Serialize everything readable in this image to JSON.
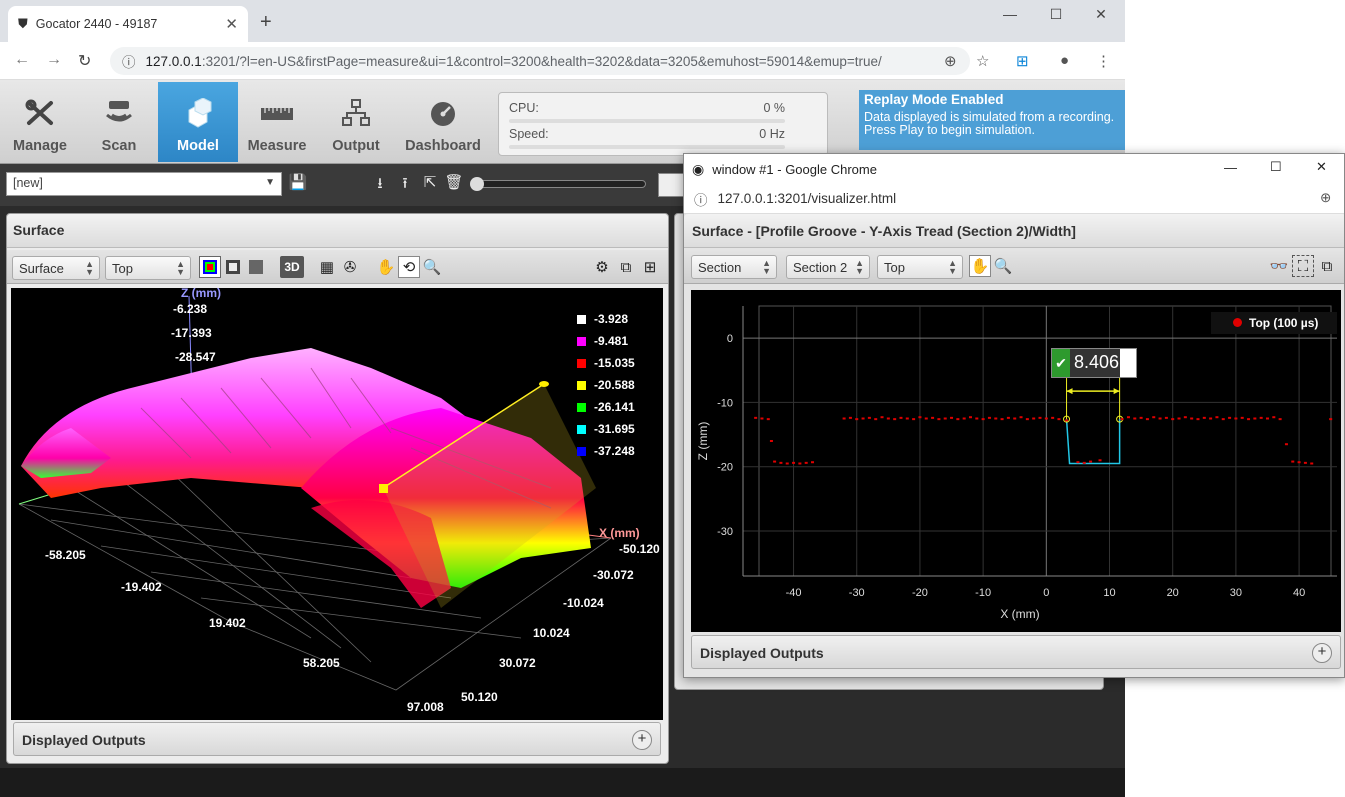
{
  "browser": {
    "tab_title": "Gocator 2440 - 49187",
    "url_host": "127.0.0.1",
    "url_rest": ":3201/?l=en-US&firstPage=measure&ui=1&control=3200&health=3202&data=3205&emuhost=59014&emup=true/"
  },
  "app": {
    "tabs": [
      {
        "label": "Manage",
        "icon": "wrench-screwdriver-icon"
      },
      {
        "label": "Scan",
        "icon": "scan-icon"
      },
      {
        "label": "Model",
        "icon": "cubes-icon",
        "active": true
      },
      {
        "label": "Measure",
        "icon": "ruler-icon"
      },
      {
        "label": "Output",
        "icon": "network-icon"
      },
      {
        "label": "Dashboard",
        "icon": "gauge-icon"
      }
    ],
    "stats": {
      "cpu_label": "CPU:",
      "cpu_value": "0 %",
      "speed_label": "Speed:",
      "speed_value": "0 Hz"
    },
    "replay": {
      "title": "Replay Mode Enabled",
      "line1": "Data displayed is simulated from a recording.",
      "line2": "Press Play to begin simulation."
    },
    "job_select_value": "[new]"
  },
  "surface_panel": {
    "title": "Surface",
    "view_select": "Surface",
    "orientation_select": "Top",
    "mode_3d_label": "3D",
    "z_axis_label": "Z (mm)",
    "x_axis_label": "X (mm)",
    "z_ticks": [
      "-6.238",
      "-17.393",
      "-28.547"
    ],
    "y_ticks": [
      "-58.205",
      "-19.402",
      "19.402",
      "58.205",
      "97.008"
    ],
    "x_ticks": [
      "-50.120",
      "-30.072",
      "-10.024",
      "10.024",
      "30.072",
      "50.120"
    ],
    "legend": [
      {
        "value": "-3.928",
        "color": "#ffffff"
      },
      {
        "value": "-9.481",
        "color": "#ff00ff"
      },
      {
        "value": "-15.035",
        "color": "#ff0000"
      },
      {
        "value": "-20.588",
        "color": "#ffff00"
      },
      {
        "value": "-26.141",
        "color": "#00ff00"
      },
      {
        "value": "-31.695",
        "color": "#00ffff"
      },
      {
        "value": "-37.248",
        "color": "#0000ff"
      }
    ],
    "displayed_outputs": "Displayed Outputs"
  },
  "popup": {
    "window_title": "window #1 - Google Chrome",
    "url": "127.0.0.1:3201/visualizer.html",
    "panel_title": "Surface - [Profile Groove - Y-Axis Tread (Section 2)/Width]",
    "select_section": "Section",
    "select_section_num": "Section 2",
    "select_view": "Top",
    "measurement_value": "8.406",
    "legend_label": "Top (100 µs)",
    "displayed_outputs": "Displayed Outputs"
  },
  "chart_data": {
    "type": "scatter",
    "xlabel": "X (mm)",
    "ylabel": "Z (mm)",
    "xlim": [
      -48,
      46
    ],
    "ylim": [
      -37,
      5
    ],
    "x_ticks": [
      -40,
      -30,
      -20,
      -10,
      0,
      10,
      20,
      30,
      40
    ],
    "y_ticks": [
      0,
      -10,
      -20,
      -30
    ],
    "series": [
      {
        "name": "Top (100 µs)",
        "color": "#e00000",
        "points": [
          [
            -46,
            -12.4
          ],
          [
            -45,
            -12.5
          ],
          [
            -44,
            -12.6
          ],
          [
            -43.5,
            -16
          ],
          [
            -43,
            -19.2
          ],
          [
            -42,
            -19.4
          ],
          [
            -41,
            -19.5
          ],
          [
            -40,
            -19.4
          ],
          [
            -39,
            -19.5
          ],
          [
            -38,
            -19.4
          ],
          [
            -37,
            -19.3
          ],
          [
            -32,
            -12.5
          ],
          [
            -31,
            -12.4
          ],
          [
            -30,
            -12.6
          ],
          [
            -29,
            -12.5
          ],
          [
            -28,
            -12.4
          ],
          [
            -27,
            -12.6
          ],
          [
            -26,
            -12.3
          ],
          [
            -25,
            -12.5
          ],
          [
            -24,
            -12.6
          ],
          [
            -23,
            -12.4
          ],
          [
            -22,
            -12.5
          ],
          [
            -21,
            -12.6
          ],
          [
            -20,
            -12.3
          ],
          [
            -19,
            -12.5
          ],
          [
            -18,
            -12.4
          ],
          [
            -17,
            -12.6
          ],
          [
            -16,
            -12.5
          ],
          [
            -15,
            -12.4
          ],
          [
            -14,
            -12.6
          ],
          [
            -13,
            -12.5
          ],
          [
            -12,
            -12.3
          ],
          [
            -11,
            -12.5
          ],
          [
            -10,
            -12.6
          ],
          [
            -9,
            -12.4
          ],
          [
            -8,
            -12.5
          ],
          [
            -7,
            -12.6
          ],
          [
            -6,
            -12.4
          ],
          [
            -5,
            -12.5
          ],
          [
            -4,
            -12.3
          ],
          [
            -3,
            -12.6
          ],
          [
            -2,
            -12.5
          ],
          [
            -1,
            -12.4
          ],
          [
            0,
            -12.5
          ],
          [
            1,
            -12.4
          ],
          [
            2,
            -12.6
          ],
          [
            3.2,
            -12.8
          ],
          [
            5,
            -19.3
          ],
          [
            6,
            -19.4
          ],
          [
            7,
            -19.2
          ],
          [
            8.5,
            -19.0
          ],
          [
            12,
            -12.6
          ],
          [
            13,
            -12.3
          ],
          [
            14,
            -12.5
          ],
          [
            15,
            -12.4
          ],
          [
            16,
            -12.6
          ],
          [
            17,
            -12.3
          ],
          [
            18,
            -12.5
          ],
          [
            19,
            -12.4
          ],
          [
            20,
            -12.6
          ],
          [
            21,
            -12.5
          ],
          [
            22,
            -12.3
          ],
          [
            23,
            -12.5
          ],
          [
            24,
            -12.6
          ],
          [
            25,
            -12.4
          ],
          [
            26,
            -12.5
          ],
          [
            27,
            -12.3
          ],
          [
            28,
            -12.6
          ],
          [
            29,
            -12.4
          ],
          [
            30,
            -12.5
          ],
          [
            31,
            -12.4
          ],
          [
            32,
            -12.6
          ],
          [
            33,
            -12.5
          ],
          [
            34,
            -12.4
          ],
          [
            35,
            -12.5
          ],
          [
            36,
            -12.3
          ],
          [
            37,
            -12.6
          ],
          [
            38,
            -16.5
          ],
          [
            39,
            -19.2
          ],
          [
            40,
            -19.3
          ],
          [
            41,
            -19.4
          ],
          [
            42,
            -19.5
          ],
          [
            45,
            -12.6
          ]
        ]
      }
    ],
    "measurement": {
      "label": "8.406",
      "x_start": 3.2,
      "x_end": 11.6,
      "z_top": -12.6,
      "z_bottom": -19.5
    },
    "legend_position": "top-right",
    "grid": true
  }
}
